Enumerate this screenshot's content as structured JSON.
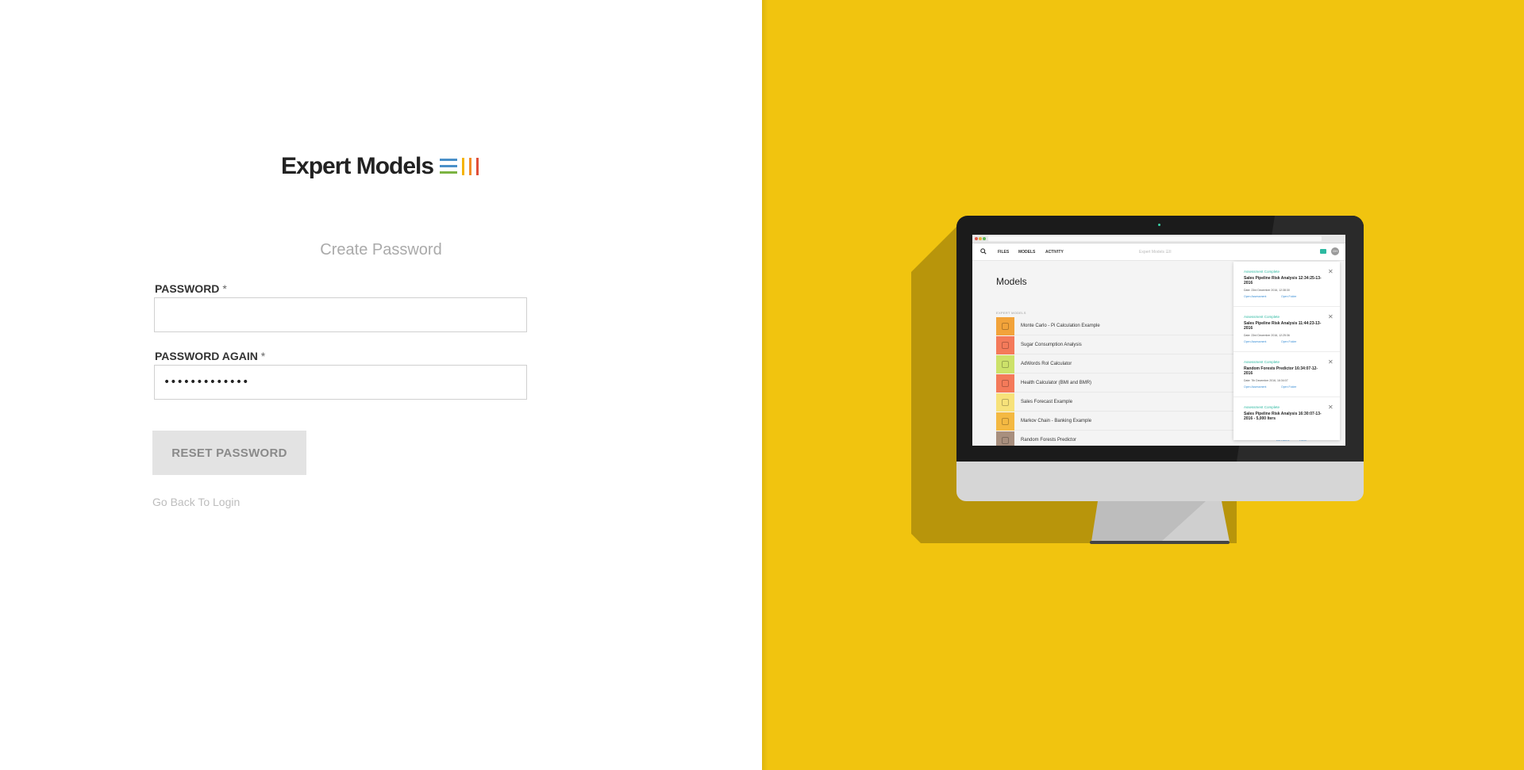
{
  "brand": {
    "name": "Expert Models",
    "mark_colors": [
      "#4a90c8",
      "#7cb342",
      "#f5b400",
      "#f28c28",
      "#e04e39"
    ]
  },
  "form": {
    "title": "Create Password",
    "password_label": "PASSWORD",
    "password_value": "",
    "password_again_label": "PASSWORD AGAIN",
    "password_again_value": "•••••••••••••",
    "required_marker": "*",
    "submit_label": "RESET PASSWORD",
    "back_link": "Go Back To Login"
  },
  "colors": {
    "right_panel_bg": "#f1c40f",
    "teal_accent": "#2db9a1"
  },
  "preview": {
    "nav": {
      "items": [
        "FILES",
        "MODELS",
        "ACTIVITY"
      ],
      "brand": "Expert Models ☰II",
      "avatar": "GH"
    },
    "page_title": "Models",
    "section_label": "EXPERT MODELS",
    "models": [
      {
        "name": "Monte Carlo - Pi Calculation Example",
        "color": "#f2a33a"
      },
      {
        "name": "Sugar Consumption Analysis",
        "color": "#f47a5a"
      },
      {
        "name": "AdWords RoI Calculator",
        "color": "#cde26a"
      },
      {
        "name": "Health Calculator (BMI and BMR)",
        "color": "#f47a5a"
      },
      {
        "name": "Sales Forecast Example",
        "color": "#f7e27a"
      },
      {
        "name": "Markov Chain - Banking Example",
        "color": "#f4b942"
      },
      {
        "name": "Random Forests Predictor",
        "color": "#a88f7e"
      }
    ],
    "row_actions": {
      "details": "DETAILS",
      "run": "RUN"
    },
    "notifications": [
      {
        "status": "Assessment Complete",
        "title": "Sales Pipeline Risk Analysis 12:34:25-13-2016",
        "date": "Date: 23rd December 2016, 12:38:30",
        "link1": "Open Assessment",
        "link2": "Open Folder"
      },
      {
        "status": "Assessment Complete",
        "title": "Sales Pipeline Risk Analysis 11:44:23-13-2016",
        "date": "Date: 23rd December 2016, 12:25:36",
        "link1": "Open Assessment",
        "link2": "Open Folder"
      },
      {
        "status": "Assessment Complete",
        "title": "Random Forests Predictor 16:34:07-12-2016",
        "date": "Date: 7th December 2016, 16:34:07",
        "link1": "Open Assessment",
        "link2": "Open Folder"
      },
      {
        "status": "Assessment Complete",
        "title": "Sales Pipeline Risk Analysis 16:30:07-13-2016 - 5,000 Iters",
        "date": "",
        "link1": "",
        "link2": ""
      }
    ]
  }
}
